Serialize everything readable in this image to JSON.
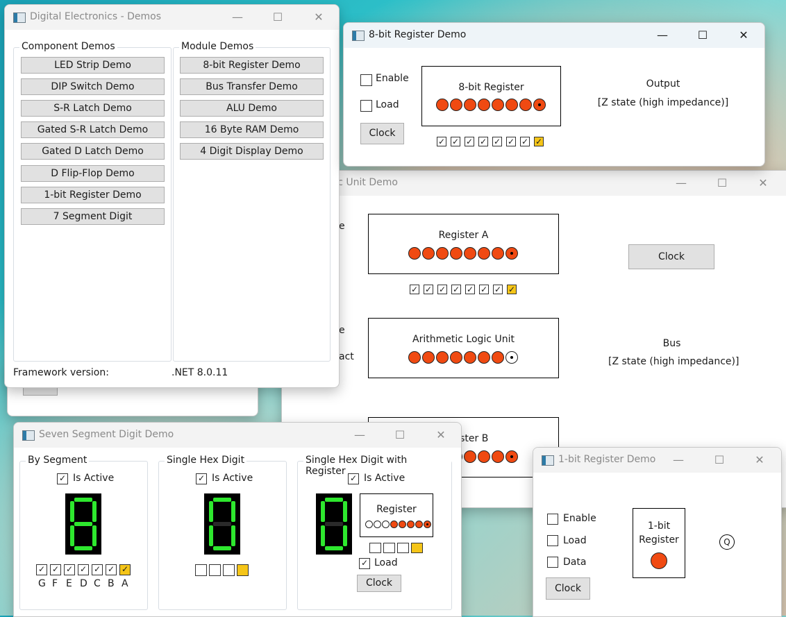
{
  "alu_window": {
    "title": "Arithmetic Logic Unit Demo",
    "register_a_label": "Register A",
    "alu_label": "Arithmetic Logic Unit",
    "register_b_label": "Register B",
    "clock_label": "Clock",
    "bus_label": "Bus",
    "bus_state": "[Z state (high impedance)]",
    "partial_labels": [
      "e",
      "e",
      "act"
    ]
  },
  "demos_window": {
    "title": "Digital Electronics - Demos",
    "component_group_label": "Component Demos",
    "component_buttons": [
      "LED Strip Demo",
      "DIP Switch Demo",
      "S-R Latch Demo",
      "Gated S-R Latch Demo",
      "Gated D Latch Demo",
      "D Flip-Flop Demo",
      "1-bit Register Demo",
      "7 Segment Digit"
    ],
    "module_group_label": "Module Demos",
    "module_buttons": [
      "8-bit Register Demo",
      "Bus Transfer Demo",
      "ALU Demo",
      "16 Byte RAM Demo",
      "4 Digit Display Demo"
    ],
    "framework_label": "Framework version:",
    "framework_value": ".NET 8.0.11"
  },
  "register8_window": {
    "title": "8-bit Register Demo",
    "enable_label": "Enable",
    "load_label": "Load",
    "clock_label": "Clock",
    "register_label": "8-bit Register",
    "output_label": "Output",
    "output_state": "[Z state (high impedance)]"
  },
  "seven_segment_window": {
    "title": "Seven Segment Digit Demo",
    "by_segment_label": "By Segment",
    "single_hex_label": "Single Hex Digit",
    "hex_register_label": "Single Hex Digit with Register",
    "is_active_label": "Is Active",
    "segment_letters": [
      "G",
      "F",
      "E",
      "D",
      "C",
      "B",
      "A"
    ],
    "register_label": "Register",
    "load_label": "Load",
    "clock_label": "Clock"
  },
  "register1_window": {
    "title": "1-bit Register Demo",
    "enable_label": "Enable",
    "load_label": "Load",
    "data_label": "Data",
    "clock_label": "Clock",
    "register_label_line1": "1-bit",
    "register_label_line2": "Register",
    "q_label": "Q"
  },
  "icons": [
    "minimize-icon",
    "maximize-icon",
    "close-icon",
    "window-app-icon"
  ],
  "colors": {
    "led_on": "#f04a12",
    "segment_on": "#2ee82e",
    "bit_highlight": "#f5c518"
  }
}
